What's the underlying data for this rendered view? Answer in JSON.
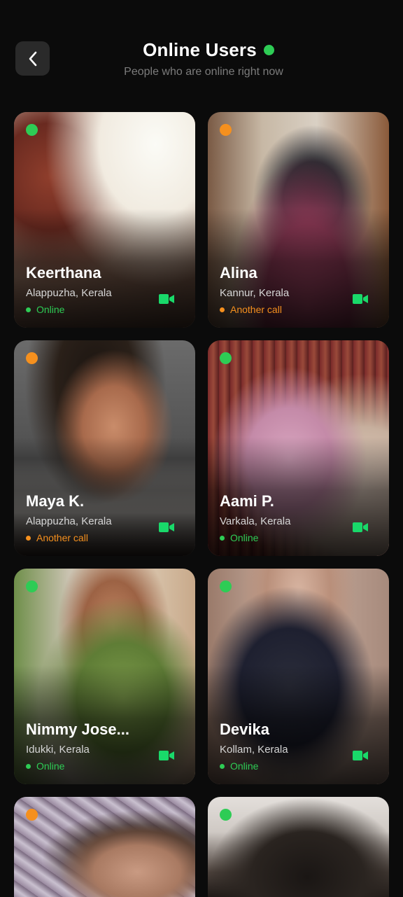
{
  "header": {
    "title": "Online Users",
    "subtitle": "People who are online right now",
    "back_icon": "chevron-left-icon",
    "status_color": "#2ecc55"
  },
  "colors": {
    "online": "#2ecc55",
    "busy": "#f5901e",
    "video": "#19d96a"
  },
  "users": [
    {
      "name": "Keerthana",
      "location": "Alappuzha, Kerala",
      "status": "Online",
      "state": "online"
    },
    {
      "name": "Alina",
      "location": "Kannur, Kerala",
      "status": "Another call",
      "state": "busy"
    },
    {
      "name": "Maya K.",
      "location": "Alappuzha, Kerala",
      "status": "Another call",
      "state": "busy"
    },
    {
      "name": "Aami P.",
      "location": "Varkala, Kerala",
      "status": "Online",
      "state": "online"
    },
    {
      "name": "Nimmy Jose...",
      "location": "Idukki, Kerala",
      "status": "Online",
      "state": "online"
    },
    {
      "name": "Devika",
      "location": "Kollam, Kerala",
      "status": "Online",
      "state": "online"
    },
    {
      "name": "",
      "location": "",
      "status": "",
      "state": "busy"
    },
    {
      "name": "",
      "location": "",
      "status": "",
      "state": "online"
    }
  ]
}
